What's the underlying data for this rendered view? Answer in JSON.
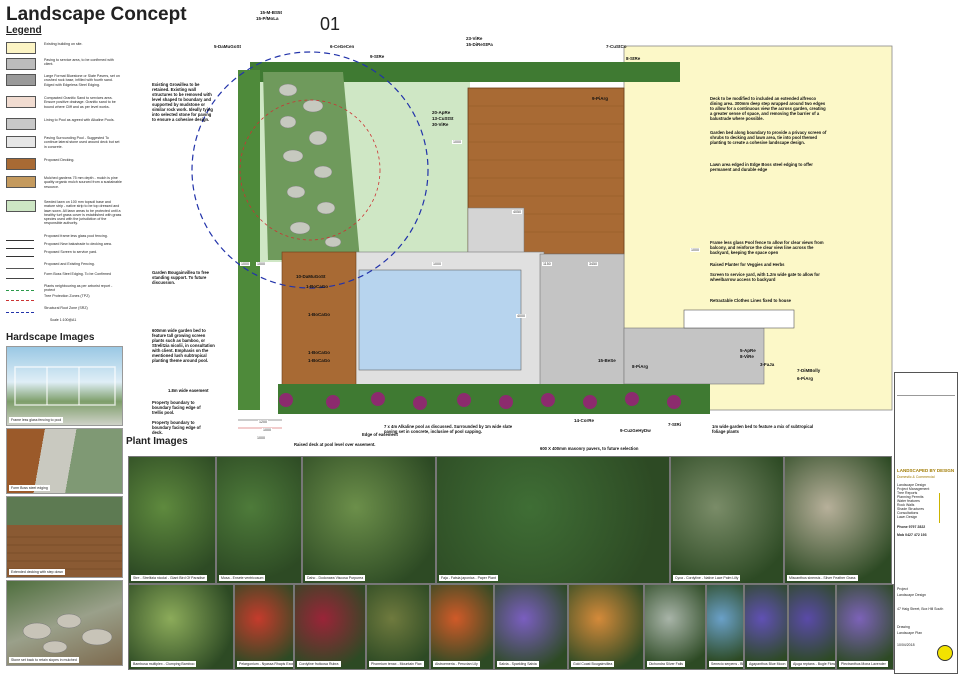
{
  "page": {
    "title": "Landscape Concept",
    "drawing_number": "01",
    "legend_title": "Legend",
    "scale": "Scale 1:100@A1",
    "hardscape_title": "Hardscape Images",
    "plant_title": "Plant Images"
  },
  "legend": [
    {
      "text": "Existing building on site.",
      "fill": "#fcf4c4"
    },
    {
      "text": "Paving to service area, to be confirmed with client.",
      "fill": "#bcbcbc"
    },
    {
      "text": "Large Format Bluestone or Slate Pavers, set on crushed rock base, infilled with fourth sand. Edged with Edgeless Steel Edging.",
      "fill": "#9a9a9a"
    },
    {
      "text": "Compacted Granitic Sand to services area. Ensure positive drainage. Granitic sand to be bound where Cliff and as per level works.",
      "fill": "#f1dcd1"
    },
    {
      "text": "Lining to Pool as agreed with Alkaline Pools.",
      "fill": "#c8c8c8"
    },
    {
      "text": "Paving Surrounding Pool - Suggested To continue lateral stone used around deck but set in concrete.",
      "fill": "#e6e6e6"
    },
    {
      "text": "Proposed Decking.",
      "fill": "#a86a34"
    },
    {
      "text": "Mulched gardens 75 mm depth - mulch is pine quality organic mulch sourced from a sustainable resource.",
      "fill": "#c49a5e"
    },
    {
      "text": "Seeded lawn on 100 mm topsoil base and mature strip - native strip to be top dressed and lawn sown. All lawn areas to be protected until a healthy turf grass cover is established with grass species used with the jurisdiction of the responsible authority.",
      "fill": "#cde6c4"
    },
    {
      "text": "Proposed frame less glass pool fencing.",
      "line": "#333333"
    },
    {
      "text": "Proposed New balustrade to decking area.",
      "line": "#333333"
    },
    {
      "text": "Proposed Screen to service yard.",
      "line": "#333333"
    },
    {
      "text": "Proposed and Existing Fencing.",
      "line": "#555555"
    },
    {
      "text": "Form Boss Steel Edging. To be Confirmed",
      "line": "#444444"
    },
    {
      "text": "Plants neighbouring as per arborist report - protect",
      "line": "#2a9a4a"
    },
    {
      "text": "Tree Protection Zones (TPZ)",
      "line": "#cc3333"
    },
    {
      "text": "Structural Root Zone (SRZ)",
      "line": "#2233aa"
    }
  ],
  "hardscape_captions": [
    "Frame less glass fencing to pool",
    "Form Boss steel edging",
    "Extended decking with step down",
    "Stone set back to retain slopes in mulched"
  ],
  "plan_labels": [
    "15-M-BS5t",
    "15-P/MoLa",
    "5-DaMuGoSt",
    "6-CeGeCen",
    "9-StRe",
    "23-ViRe",
    "15-DiReStPa",
    "7-CuStCo",
    "8-StRe",
    "9-PiArg",
    "20-ApRe",
    "13-CuStSt",
    "30-ViRe",
    "10-DaMuGoSt",
    "1-BoCaGo",
    "1-BoCaGo",
    "1-BoCaGo",
    "1-BoCaGo",
    "15-BeSe",
    "8-PiArg",
    "3-FaJa",
    "5-ApRe",
    "8-ViRe",
    "7-DiMBolly",
    "6-PiArg",
    "14-CorRe",
    "9-CuzGeHyDw",
    "7-StRi"
  ],
  "notes": [
    "Existing Growillea to be retained. Existing wall structures to be removed with level shaped to boundary and supported by mudstone or similar rock work. Ideally tying into selected stone for paving to ensure a cohesive design.",
    "Deck to be modified to included an extended alfresco dining area. 300mm deep step wrapped around two edges to allow for a continuous view the across garden, creating a greater sense of space, and removing the barrier of a balustrade where possible.",
    "Garden bed along boundary to provide a privacy screen of shrubs to decking and lawn area, tie into pool themed planting to create a cohesive landscape design.",
    "Lawn area edged in Edge Boss steel edging to offer permanent and durable edge",
    "Frame less glass Pool fence to allow for clear views from balcony, and reinforce the clear view line across the backyard, keeping the space open",
    "Raised Planter for Veggies and Herbs",
    "Screen to service yard, with 1.2m wide gate to allow for wheelbarrow access to backyard",
    "Retractable Clothes Lines fixed to house",
    "Garden Bougainvillea to free standing support. To future discussion.",
    "600mm wide garden bed to feature tall growing screen plants such as bamboo, or Strelitzia nicolii, in consultation with client. Emphasis on the mentioned lush subtropical planting theme around pool.",
    "1.8m wide easement",
    "Property boundary to boundary facing edge of trellis pool.",
    "Property boundary to boundary facing edge of deck.",
    "Raised deck at pool level over easement.",
    "Edge of easement",
    "7 x 4m Alkaline pool as discussed. Surrounded by 1m wide slate paving set in concrete, inclusive of pool capping.",
    "600 X 400mm masonry pavers, to future selection",
    "1m wide garden bed to feature a mix of subtropical foliage plants"
  ],
  "dimensions": [
    "1000",
    "4050",
    "1000",
    "1150",
    "3450",
    "4000",
    "1000",
    "1000",
    "1200",
    "1000",
    "1000",
    "1000"
  ],
  "plant_captions": [
    "Stre - Strelitzia nicolai - Giant Bird Of Paradise",
    "Musa - Ensete ventricosum",
    "Daho - Dodonaea Viscosa Purpurea",
    "Faja - Fatsia japonica - Paper Plant",
    "Cyca - Cordyline - Native Lace Palm Lilly",
    "Miscanthus sinensis - Silver Feather Grass",
    "Bambusa multiplex - Clumping Bamboo",
    "Pelargonium - Nyassa Rhapis Excelsa",
    "Cordyline fruticosa Rubra",
    "Phormium tenax - Mountain Flax",
    "Alstroemeria - Peruvian Lily",
    "Salvia - Sparkling Salvia",
    "Gold Coast Bougainvillea",
    "Dichondra Silver Falls",
    "Senecio serpens - Blue Chalk Sticks",
    "Agapanthus Blue Moon",
    "Ajuga reptans - Bugle Flower",
    "Plectranthus Mona Lavender"
  ],
  "title_block": {
    "company": "LANDSCAPED BY DESIGN",
    "tagline": "Domestic & Commercial",
    "services": [
      "Landscape Design",
      "Project Management",
      "Tree Reports",
      "Planning Permits",
      "Water features",
      "Rock Walls",
      "Shade Structures",
      "Consultations",
      "Lawn Design"
    ],
    "phone_label": "Phone 9797 2822",
    "mobile_label": "Mob 0427 472 193",
    "project_label": "Project",
    "project": "Landscape Design",
    "address": "47 Haig Street, Box Hill South",
    "drawing_label": "Drawing",
    "drawing": "Landscape Plan",
    "date": "10/04/2018"
  },
  "colors": {
    "lawn": "#cfe7c5",
    "deck": "#a86a34",
    "building": "#fcf8c8",
    "paving": "#c4c4c4",
    "pool": "#b7d4ee",
    "garden": "#4e8a3a",
    "srz": "#2233aa"
  }
}
